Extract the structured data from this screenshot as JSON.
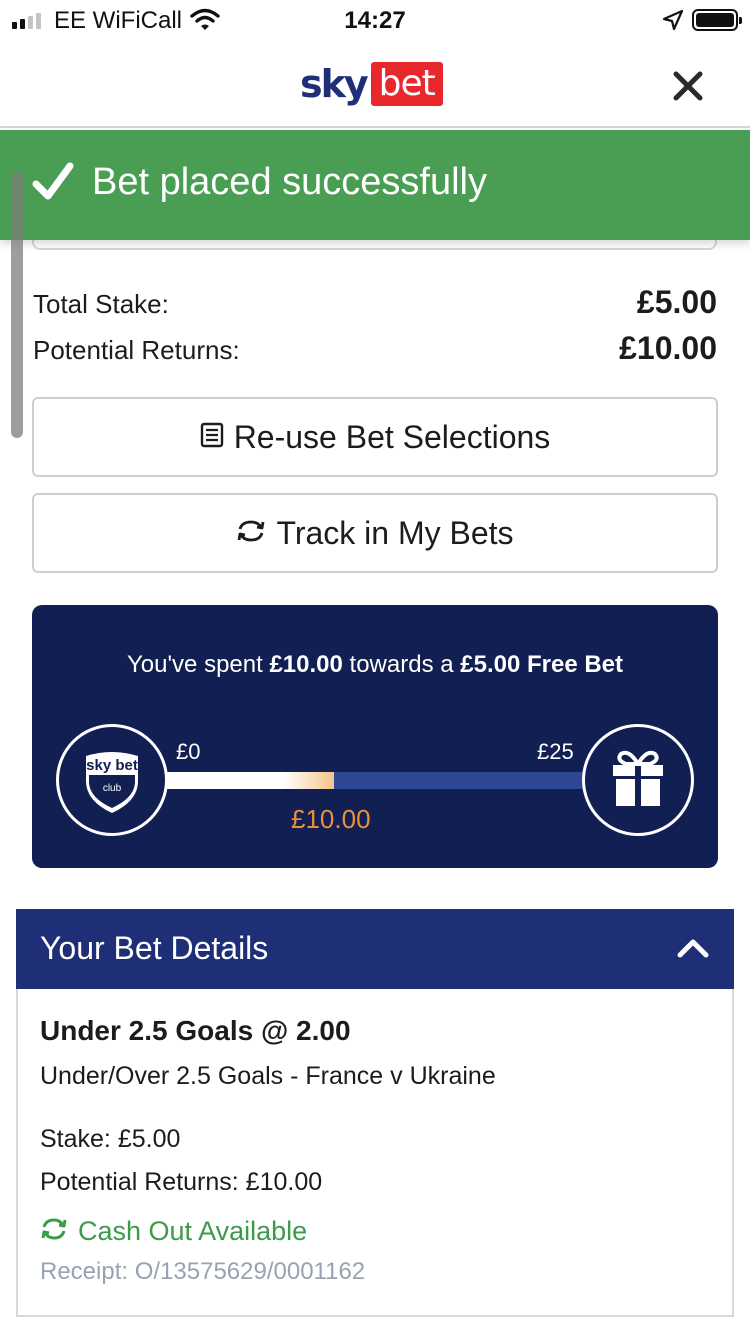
{
  "status_bar": {
    "carrier": "EE WiFiCall",
    "time": "14:27"
  },
  "header": {
    "logo_sky": "sky",
    "logo_bet": "bet"
  },
  "banner": {
    "message": "Bet placed successfully",
    "color": "#4a9e53"
  },
  "totals": {
    "stake_label": "Total Stake:",
    "stake_value": "£5.00",
    "returns_label": "Potential Returns:",
    "returns_value": "£10.00"
  },
  "actions": {
    "reuse_label": "Re-use Bet Selections",
    "track_label": "Track in My Bets"
  },
  "club": {
    "text_1": "You've spent ",
    "spent": "£10.00",
    "text_2": " towards a ",
    "reward": "£5.00 Free Bet",
    "badge_line1": "sky bet",
    "badge_line2": "club",
    "min_label": "£0",
    "max_label": "£25",
    "current_label": "£10.00",
    "progress_fraction": 0.4
  },
  "details": {
    "header_title": "Your Bet Details",
    "bet_title": "Under 2.5 Goals @ 2.00",
    "market": "Under/Over 2.5 Goals - France v Ukraine",
    "stake": "Stake: £5.00",
    "returns": "Potential Returns: £10.00",
    "cashout": "Cash Out Available",
    "receipt": "Receipt: O/13575629/0001162"
  },
  "colors": {
    "brand_navy": "#1e2f77",
    "panel_navy": "#121f52",
    "brand_red": "#e8282d",
    "cashout_green": "#3c9b4a",
    "progress_orange": "#e9903a"
  }
}
